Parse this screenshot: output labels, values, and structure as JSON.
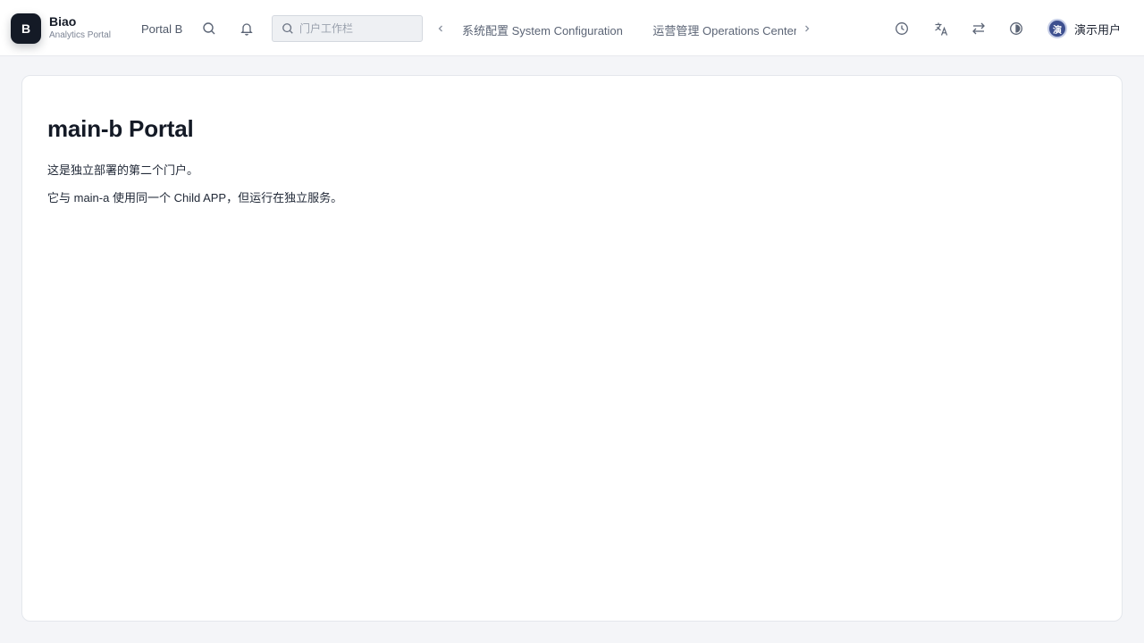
{
  "brand": {
    "logo_letter": "B",
    "name": "Biao",
    "subtitle": "Analytics Portal"
  },
  "header": {
    "portal_label": "Portal B",
    "search_placeholder": "门户工作栏",
    "nav_tabs": [
      "系统配置 System Configuration",
      "运营管理 Operations Center"
    ],
    "user": {
      "avatar_letter": "演",
      "name": "演示用户"
    }
  },
  "main": {
    "title": "main-b Portal",
    "paragraphs": [
      "这是独立部署的第二个门户。",
      "它与 main-a 使用同一个 Child APP，但运行在独立服务。"
    ]
  },
  "icons": [
    "search-icon",
    "bell-icon",
    "chevron-left-icon",
    "chevron-right-icon",
    "clock-icon",
    "translate-icon",
    "switch-icon",
    "theme-icon"
  ]
}
